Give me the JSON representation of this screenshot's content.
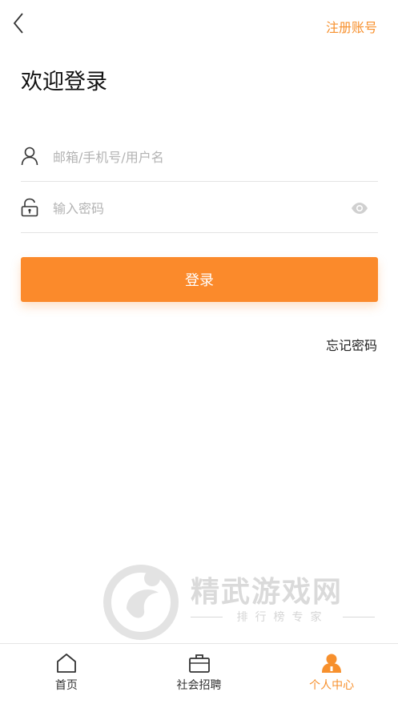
{
  "header": {
    "register_label": "注册账号"
  },
  "title": "欢迎登录",
  "form": {
    "username_placeholder": "邮箱/手机号/用户名",
    "password_placeholder": "输入密码",
    "login_label": "登录",
    "forgot_label": "忘记密码"
  },
  "watermark": {
    "title": "精武游戏网",
    "subtitle": "排行榜专家"
  },
  "tabbar": {
    "items": [
      {
        "label": "首页",
        "icon": "home-icon",
        "active": false
      },
      {
        "label": "社会招聘",
        "icon": "briefcase-icon",
        "active": false
      },
      {
        "label": "个人中心",
        "icon": "person-icon",
        "active": true
      }
    ]
  },
  "colors": {
    "accent": "#f7902d",
    "button": "#fb8a2b"
  }
}
